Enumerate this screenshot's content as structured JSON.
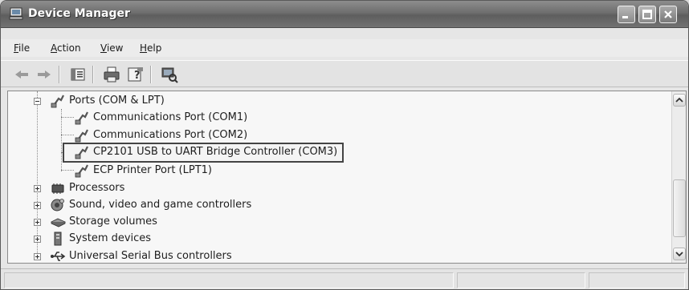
{
  "window": {
    "title": "Device Manager"
  },
  "menu": {
    "items": [
      "File",
      "Action",
      "View",
      "Help"
    ]
  },
  "toolbar": {
    "icons": [
      "back-arrow-icon",
      "forward-arrow-icon",
      "properties-icon",
      "print-icon",
      "help-icon",
      "scan-hardware-icon"
    ]
  },
  "tree": {
    "ports": {
      "label": "Ports (COM & LPT)",
      "children": [
        "Communications Port (COM1)",
        "Communications Port (COM2)",
        "CP2101 USB to UART Bridge Controller (COM3)",
        "ECP Printer Port (LPT1)"
      ]
    },
    "categories": [
      "Processors",
      "Sound, video and game controllers",
      "Storage volumes",
      "System devices",
      "Universal Serial Bus controllers"
    ]
  }
}
